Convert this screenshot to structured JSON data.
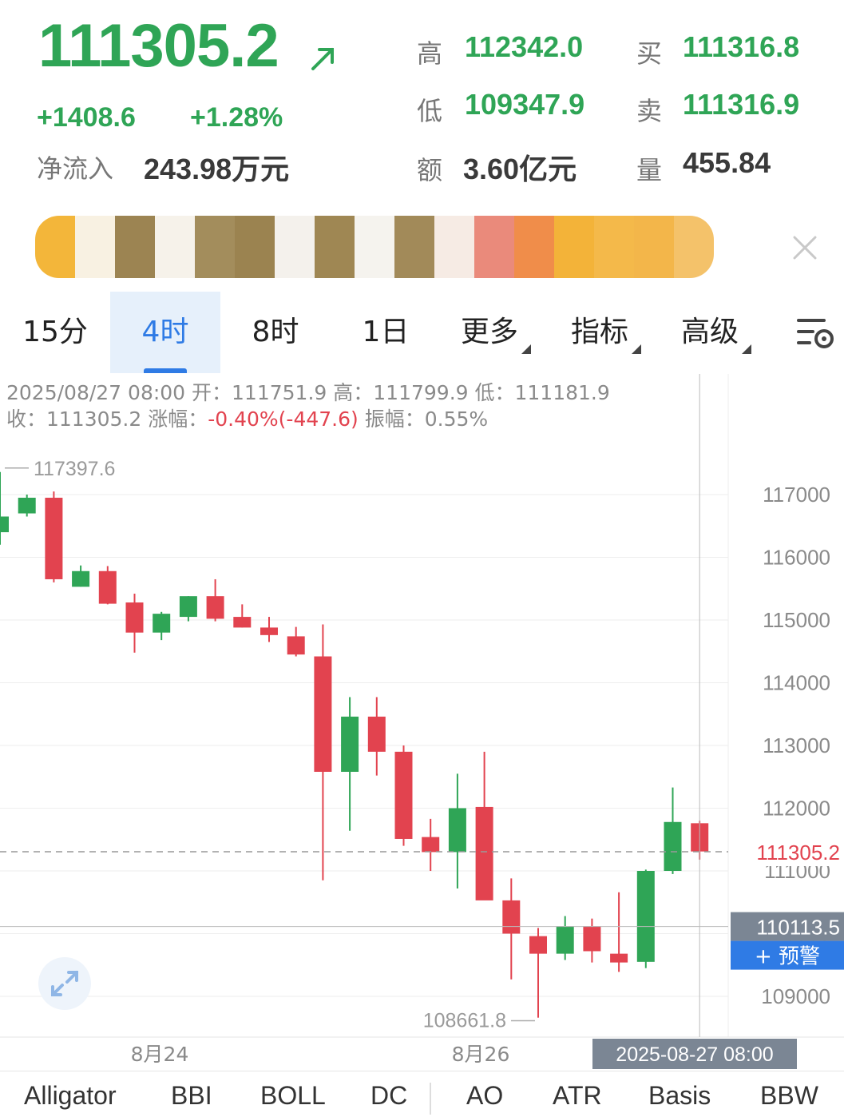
{
  "quote": {
    "last_price": "111305.2",
    "change": "+1408.6",
    "change_pct": "+1.28%",
    "net_inflow_label": "净流入",
    "net_inflow_value": "243.98万元"
  },
  "stats": {
    "high_label": "高",
    "high_value": "112342.0",
    "low_label": "低",
    "low_value": "109347.9",
    "amount_label": "额",
    "amount_value": "3.60亿元",
    "bid_label": "买",
    "bid_value": "111316.8",
    "ask_label": "卖",
    "ask_value": "111316.9",
    "volume_label": "量",
    "volume_value": "455.84"
  },
  "tabs": [
    {
      "label": "15分"
    },
    {
      "label": "4时",
      "active": true
    },
    {
      "label": "8时"
    },
    {
      "label": "1日"
    },
    {
      "label": "更多"
    },
    {
      "label": "指标"
    },
    {
      "label": "高级"
    }
  ],
  "ohlc": {
    "line1": "2025/08/27 08:00 开：111751.9 高：111799.9 低：111181.9",
    "close_label": "收：111305.2 涨幅：",
    "change_text": "-0.40%(-447.6)",
    "amplitude": " 振幅：0.55%"
  },
  "colors": {
    "up": "#2fa556",
    "down": "#e2434f",
    "accent": "#2f7be5"
  },
  "chart_data": {
    "type": "candlestick",
    "interval": "4h",
    "ylim": [
      108200,
      118000
    ],
    "y_ticks": [
      117000,
      116000,
      115000,
      114000,
      113000,
      112000,
      111000,
      110000,
      109000
    ],
    "x_labels": [
      "8月24",
      "8月26"
    ],
    "last_price_label": "111305.2",
    "crosshair_price_label": "110113.5",
    "crosshair_time_label": "2025-08-27 08:00",
    "alert_button_label": "+ 预警",
    "max_marker": "117397.6",
    "min_marker": "108661.8",
    "candles": [
      {
        "o": 116400,
        "h": 117360,
        "l": 116200,
        "c": 116650
      },
      {
        "o": 116700,
        "h": 117000,
        "l": 116650,
        "c": 116950
      },
      {
        "o": 116950,
        "h": 117050,
        "l": 115600,
        "c": 115650
      },
      {
        "o": 115530,
        "h": 115870,
        "l": 115530,
        "c": 115780
      },
      {
        "o": 115780,
        "h": 115860,
        "l": 115250,
        "c": 115260
      },
      {
        "o": 115280,
        "h": 115420,
        "l": 114480,
        "c": 114800
      },
      {
        "o": 114800,
        "h": 115130,
        "l": 114680,
        "c": 115100
      },
      {
        "o": 115050,
        "h": 115380,
        "l": 114980,
        "c": 115380
      },
      {
        "o": 115380,
        "h": 115650,
        "l": 114980,
        "c": 115020
      },
      {
        "o": 115050,
        "h": 115250,
        "l": 114880,
        "c": 114880
      },
      {
        "o": 114880,
        "h": 115050,
        "l": 114650,
        "c": 114760
      },
      {
        "o": 114740,
        "h": 114890,
        "l": 114420,
        "c": 114450
      },
      {
        "o": 114420,
        "h": 114930,
        "l": 110850,
        "c": 112580
      },
      {
        "o": 112580,
        "h": 113770,
        "l": 111640,
        "c": 113460
      },
      {
        "o": 113460,
        "h": 113770,
        "l": 112520,
        "c": 112900
      },
      {
        "o": 112900,
        "h": 113000,
        "l": 111400,
        "c": 111510
      },
      {
        "o": 111540,
        "h": 111830,
        "l": 111000,
        "c": 111300
      },
      {
        "o": 111300,
        "h": 112550,
        "l": 110720,
        "c": 112000
      },
      {
        "o": 112020,
        "h": 112900,
        "l": 110650,
        "c": 110530
      },
      {
        "o": 110530,
        "h": 110880,
        "l": 109270,
        "c": 110000
      },
      {
        "o": 109960,
        "h": 110090,
        "l": 108660,
        "c": 109680
      },
      {
        "o": 109680,
        "h": 110280,
        "l": 109580,
        "c": 110120
      },
      {
        "o": 110120,
        "h": 110240,
        "l": 109540,
        "c": 109720
      },
      {
        "o": 109680,
        "h": 110660,
        "l": 109390,
        "c": 109540
      },
      {
        "o": 109550,
        "h": 111020,
        "l": 109450,
        "c": 111000
      },
      {
        "o": 111000,
        "h": 112330,
        "l": 110950,
        "c": 111780
      },
      {
        "o": 111760,
        "h": 111800,
        "l": 111180,
        "c": 111310
      }
    ]
  },
  "indicators": [
    "Alligator",
    "BBI",
    "BOLL",
    "DC",
    "AO",
    "ATR",
    "Basis",
    "BBW"
  ]
}
